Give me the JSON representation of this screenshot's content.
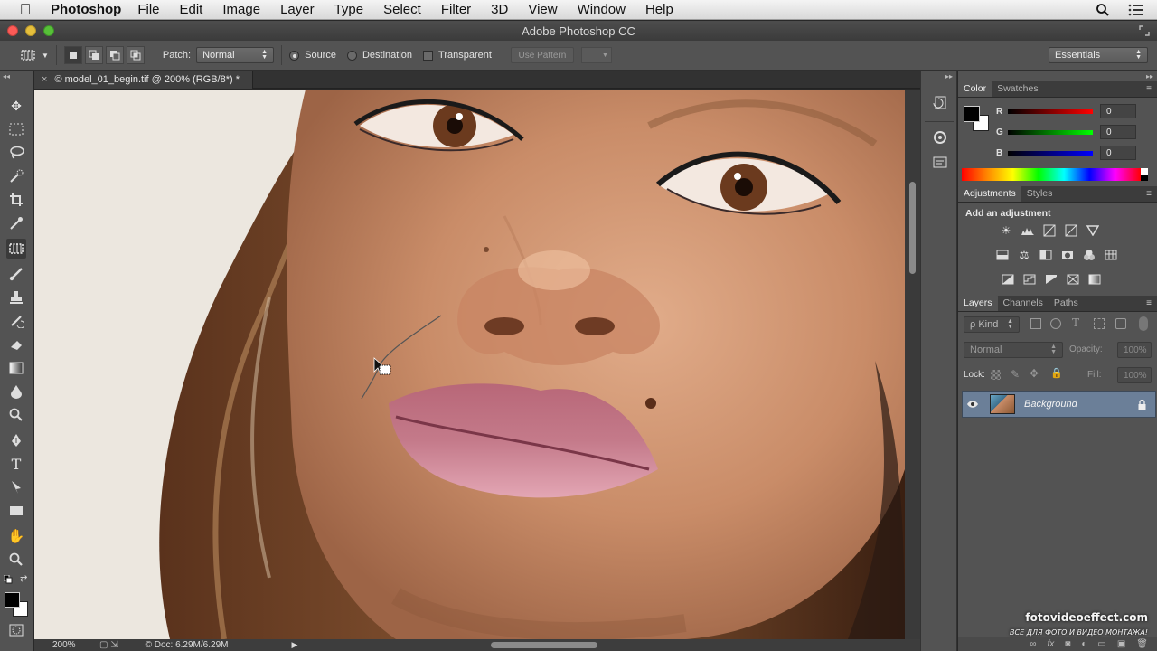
{
  "menubar": {
    "app_name": "Photoshop",
    "items": [
      "File",
      "Edit",
      "Image",
      "Layer",
      "Type",
      "Select",
      "Filter",
      "3D",
      "View",
      "Window",
      "Help"
    ]
  },
  "window": {
    "title": "Adobe Photoshop CC"
  },
  "options": {
    "patch_label": "Patch:",
    "patch_mode": "Normal",
    "source_label": "Source",
    "destination_label": "Destination",
    "transparent_label": "Transparent",
    "use_pattern_label": "Use Pattern",
    "workspace": "Essentials",
    "source_selected": true
  },
  "document": {
    "tab_title": "© model_01_begin.tif @ 200% (RGB/8*) *"
  },
  "status": {
    "zoom": "200%",
    "doc_size": "© Doc: 6.29M/6.29M"
  },
  "color_panel": {
    "tabs": [
      "Color",
      "Swatches"
    ],
    "r": "0",
    "g": "0",
    "b": "0",
    "r_label": "R",
    "g_label": "G",
    "b_label": "B"
  },
  "adjustments_panel": {
    "tabs": [
      "Adjustments",
      "Styles"
    ],
    "heading": "Add an adjustment"
  },
  "layers_panel": {
    "tabs": [
      "Layers",
      "Channels",
      "Paths"
    ],
    "filter": "ρ Kind",
    "blend_mode": "Normal",
    "opacity_label": "Opacity:",
    "opacity": "100%",
    "lock_label": "Lock:",
    "fill_label": "Fill:",
    "fill": "100%",
    "layers": [
      {
        "name": "Background",
        "locked": true,
        "visible": true
      }
    ]
  },
  "watermark": {
    "site": "fotovideoeffect.com",
    "tagline": "ВСЕ ДЛЯ ФОТО И ВИДЕО МОНТАЖА!"
  },
  "colors": {
    "ui_bg": "#535353",
    "selected_layer": "#6b7f98",
    "foreground": "#000000",
    "background": "#ffffff"
  }
}
